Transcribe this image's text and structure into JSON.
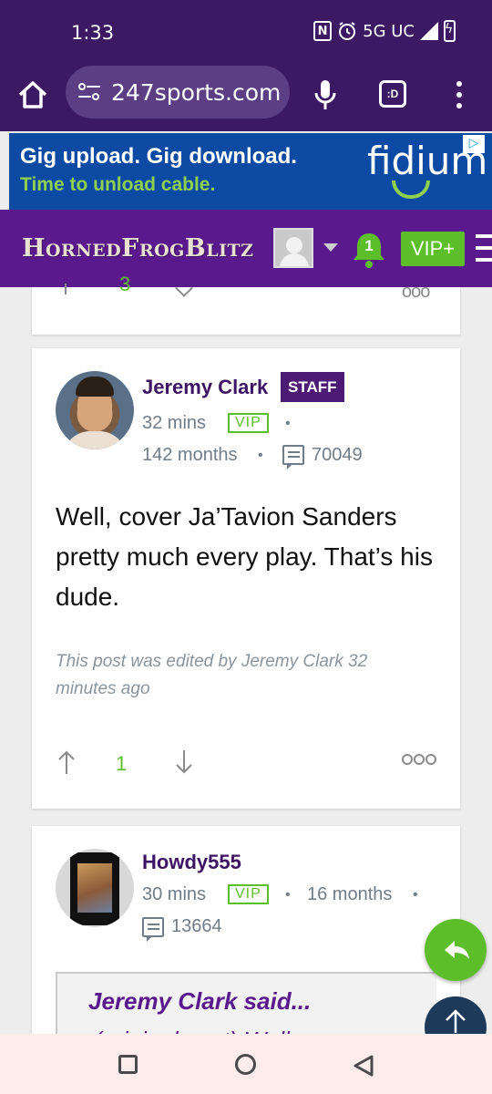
{
  "status_bar": {
    "time": "1:33",
    "network": "5G UC",
    "icons": [
      "nfc-icon",
      "alarm-icon",
      "signal-icon",
      "battery-charging-icon"
    ]
  },
  "browser": {
    "url": "247sports.com",
    "icons": [
      "home-icon",
      "site-settings-icon",
      "mic-icon",
      "tabs-icon",
      "menu-icon"
    ]
  },
  "ad": {
    "headline": "Gig upload. Gig download.",
    "subline": "Time to unload cable.",
    "brand": "fidium"
  },
  "site_nav": {
    "logo": "HornedFrogBlitz",
    "notification_count": "1",
    "vip_label": "VIP+"
  },
  "prev_post": {
    "vote_count": "3"
  },
  "post": {
    "username": "Jeremy Clark",
    "role_badge": "STAFF",
    "time_ago": "32 mins",
    "vip_badge": "VIP",
    "membership": "142 months",
    "post_count": "70049",
    "body": "Well, cover Ja’Tavion Sanders pretty much every play. That’s his dude.",
    "edited_note": "This post was edited by Jeremy Clark 32 minutes ago",
    "vote_count": "1"
  },
  "next_post": {
    "username": "Howdy555",
    "time_ago": "30 mins",
    "vip_badge": "VIP",
    "membership": "16 months",
    "post_count": "13664",
    "quote_header": "Jeremy Clark said...",
    "quote_peek": "(original post) Well"
  },
  "colors": {
    "browser_bar": "#3b1a63",
    "site_purple": "#5a1a8e",
    "accent_green": "#5cbf2a",
    "staff_badge": "#4d1a74",
    "ad_blue": "#0d4aa3"
  }
}
